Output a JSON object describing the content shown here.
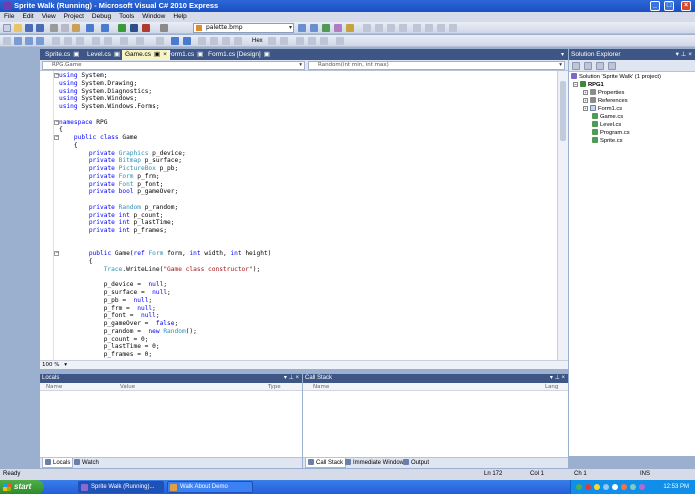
{
  "window": {
    "title": "Sprite Walk (Running) - Microsoft Visual C# 2010 Express",
    "minimize": "_",
    "maximize": "□",
    "close": "×"
  },
  "menu": [
    "File",
    "Edit",
    "View",
    "Project",
    "Debug",
    "Tools",
    "Window",
    "Help"
  ],
  "toolbar": {
    "find_combo": "palette.bmp",
    "hex_label": "Hex"
  },
  "tabs": [
    {
      "label": "Sprite.cs"
    },
    {
      "label": "Level.cs"
    },
    {
      "label": "Game.cs"
    },
    {
      "label": "Form1.cs"
    },
    {
      "label": "Form1.cs [Design]"
    }
  ],
  "navbar": {
    "type_combo": "RPG.Game",
    "member_combo": "Random(int min, int max)"
  },
  "editor": {
    "zoom": "100 %",
    "lines": [
      [
        [
          "kw",
          "using"
        ],
        [
          "",
          "System;"
        ]
      ],
      [
        [
          "kw",
          "using"
        ],
        [
          "",
          "System.Drawing;"
        ]
      ],
      [
        [
          "kw",
          "using"
        ],
        [
          "",
          "System.Diagnostics;"
        ]
      ],
      [
        [
          "kw",
          "using"
        ],
        [
          "",
          "System.Windows;"
        ]
      ],
      [
        [
          "kw",
          "using"
        ],
        [
          "",
          "System.Windows.Forms;"
        ]
      ],
      [],
      [
        [
          "kw",
          "namespace"
        ],
        [
          "",
          "RPG"
        ]
      ],
      [
        [
          "",
          "{"
        ]
      ],
      [
        [
          "",
          "    "
        ],
        [
          "kw",
          "public class"
        ],
        [
          "",
          "Game"
        ]
      ],
      [
        [
          "",
          "    {"
        ]
      ],
      [
        [
          "",
          "        "
        ],
        [
          "kw",
          "private"
        ],
        [
          "ty",
          "Graphics"
        ],
        [
          "",
          "p_device;"
        ]
      ],
      [
        [
          "",
          "        "
        ],
        [
          "kw",
          "private"
        ],
        [
          "ty",
          "Bitmap"
        ],
        [
          "",
          "p_surface;"
        ]
      ],
      [
        [
          "",
          "        "
        ],
        [
          "kw",
          "private"
        ],
        [
          "ty",
          "PictureBox"
        ],
        [
          "",
          "p_pb;"
        ]
      ],
      [
        [
          "",
          "        "
        ],
        [
          "kw",
          "private"
        ],
        [
          "ty",
          "Form"
        ],
        [
          "",
          "p_frm;"
        ]
      ],
      [
        [
          "",
          "        "
        ],
        [
          "kw",
          "private"
        ],
        [
          "ty",
          "Font"
        ],
        [
          "",
          "p_font;"
        ]
      ],
      [
        [
          "",
          "        "
        ],
        [
          "kw",
          "private bool"
        ],
        [
          "",
          "p_gameOver;"
        ]
      ],
      [],
      [
        [
          "",
          "        "
        ],
        [
          "kw",
          "private"
        ],
        [
          "ty",
          "Random"
        ],
        [
          "",
          "p_random;"
        ]
      ],
      [
        [
          "",
          "        "
        ],
        [
          "kw",
          "private int"
        ],
        [
          "",
          "p_count;"
        ]
      ],
      [
        [
          "",
          "        "
        ],
        [
          "kw",
          "private int"
        ],
        [
          "",
          "p_lastTime;"
        ]
      ],
      [
        [
          "",
          "        "
        ],
        [
          "kw",
          "private int"
        ],
        [
          "",
          "p_frames;"
        ]
      ],
      [],
      [],
      [
        [
          "",
          "        "
        ],
        [
          "kw",
          "public"
        ],
        [
          "",
          "Game("
        ],
        [
          "kw",
          "ref"
        ],
        [
          "ty",
          "Form"
        ],
        [
          "",
          "form,"
        ],
        [
          "kw",
          "int"
        ],
        [
          "",
          "width,"
        ],
        [
          "kw",
          "int"
        ],
        [
          "",
          "height)"
        ]
      ],
      [
        [
          "",
          "        {"
        ]
      ],
      [
        [
          "",
          "            "
        ],
        [
          "ty",
          "Trace"
        ],
        [
          "",
          ".WriteLine("
        ],
        [
          "str",
          "\"Game class constructor\""
        ],
        [
          "",
          ");"
        ]
      ],
      [],
      [
        [
          "",
          "            p_device = "
        ],
        [
          "kw",
          "null"
        ],
        [
          "",
          ";"
        ]
      ],
      [
        [
          "",
          "            p_surface = "
        ],
        [
          "kw",
          "null"
        ],
        [
          "",
          ";"
        ]
      ],
      [
        [
          "",
          "            p_pb = "
        ],
        [
          "kw",
          "null"
        ],
        [
          "",
          ";"
        ]
      ],
      [
        [
          "",
          "            p_frm = "
        ],
        [
          "kw",
          "null"
        ],
        [
          "",
          ";"
        ]
      ],
      [
        [
          "",
          "            p_font = "
        ],
        [
          "kw",
          "null"
        ],
        [
          "",
          ";"
        ]
      ],
      [
        [
          "",
          "            p_gameOver = "
        ],
        [
          "kw",
          "false"
        ],
        [
          "",
          ";"
        ]
      ],
      [
        [
          "",
          "            p_random = "
        ],
        [
          "kw",
          "new"
        ],
        [
          "ty",
          "Random"
        ],
        [
          "",
          "();"
        ]
      ],
      [
        [
          "",
          "            p_count = 0;"
        ]
      ],
      [
        [
          "",
          "            p_lastTime = 0;"
        ]
      ],
      [
        [
          "",
          "            p_frames = 0;"
        ]
      ]
    ]
  },
  "solution_explorer": {
    "title": "Solution Explorer",
    "items": [
      {
        "label": "Solution 'Sprite Walk' (1 project)",
        "indent": 0
      },
      {
        "label": "RPG1",
        "indent": 1,
        "bold": true
      },
      {
        "label": "Properties",
        "indent": 2
      },
      {
        "label": "References",
        "indent": 2
      },
      {
        "label": "Form1.cs",
        "indent": 2
      },
      {
        "label": "Game.cs",
        "indent": 2
      },
      {
        "label": "Level.cs",
        "indent": 2
      },
      {
        "label": "Program.cs",
        "indent": 2
      },
      {
        "label": "Sprite.cs",
        "indent": 2
      }
    ]
  },
  "locals_pane": {
    "title": "Locals",
    "columns": [
      "Name",
      "Value",
      "Type"
    ],
    "tabs": [
      "Locals",
      "Watch"
    ]
  },
  "callstack_pane": {
    "title": "Call Stack",
    "columns": [
      "Name",
      "Lang"
    ],
    "tabs": [
      "Call Stack",
      "Immediate Window",
      "Output"
    ]
  },
  "pane_controls": "▾ ⊥ ×",
  "status": {
    "ready": "Ready",
    "line": "Ln 172",
    "col": "Col 1",
    "ch": "Ch 1",
    "ins": "INS"
  },
  "taskbar": {
    "start": "start",
    "items": [
      "Sprite Walk (Running)...",
      "Walk About Demo"
    ],
    "clock": "12:53 PM"
  }
}
